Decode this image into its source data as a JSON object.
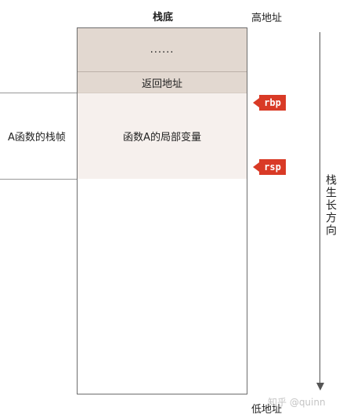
{
  "stack_title": "栈底",
  "high_address": "高地址",
  "low_address": "低地址",
  "segments": {
    "ellipsis": "......",
    "return_address": "返回地址",
    "locals": "函数A的局部变量"
  },
  "frame_label": "A函数的栈帧",
  "registers": {
    "rbp": "rbp",
    "rsp": "rsp"
  },
  "growth_direction": "栈生长方向",
  "watermark": "知乎 @quinn",
  "colors": {
    "upper_segments": "#e2d8d0",
    "locals_segment": "#f6f0ed",
    "register_tag": "#d93a26"
  }
}
